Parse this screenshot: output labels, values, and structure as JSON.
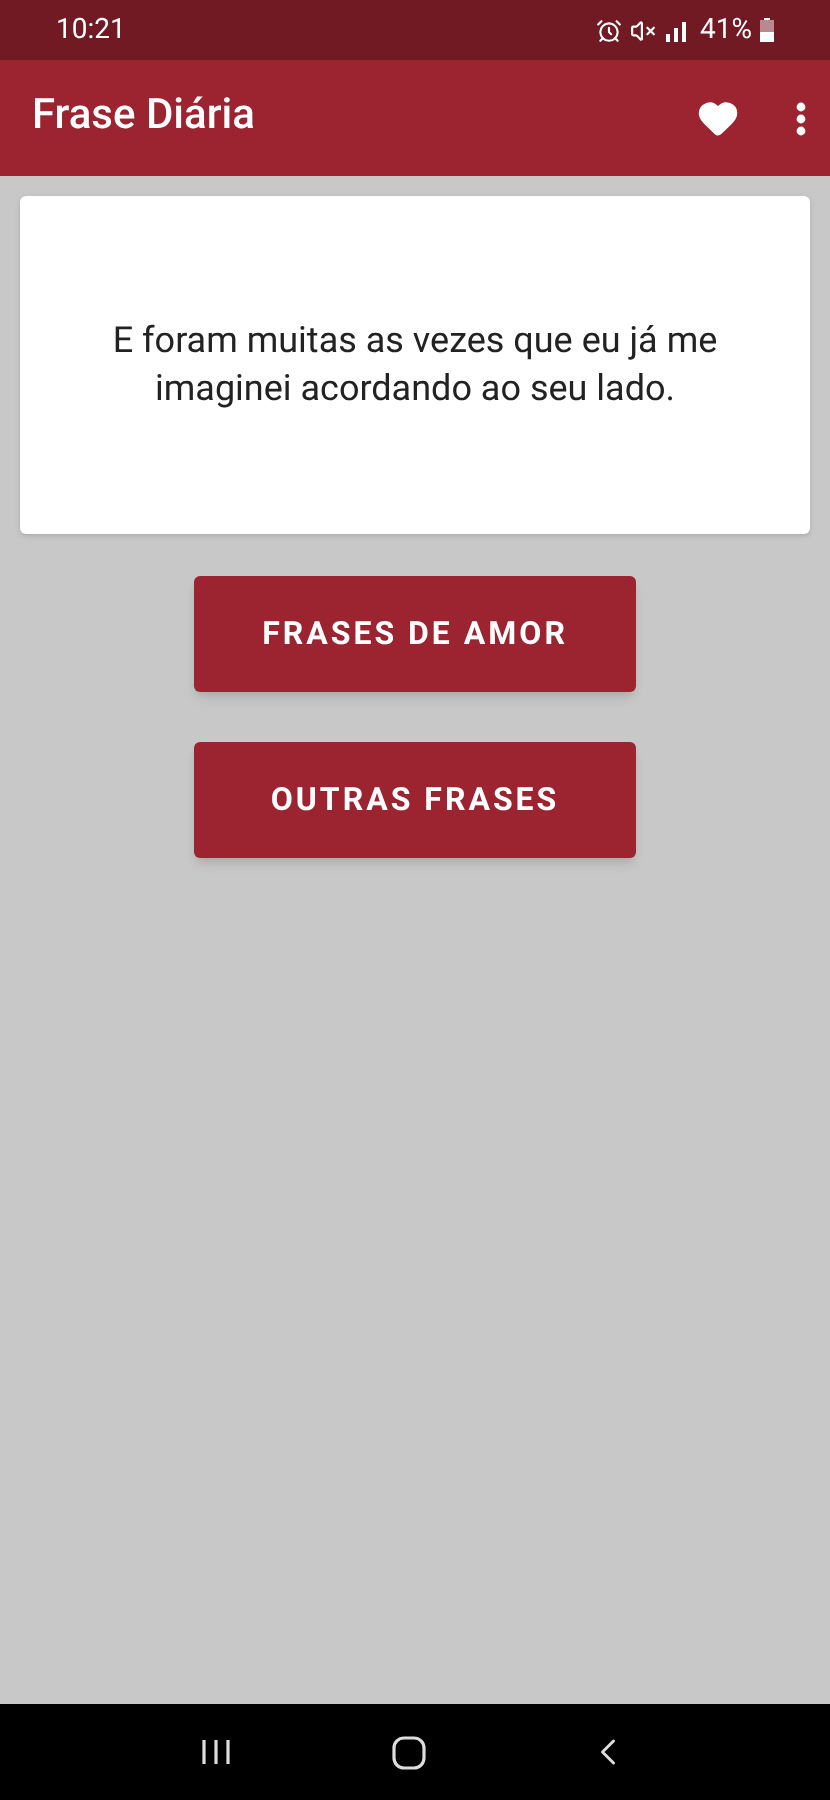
{
  "status_bar": {
    "time": "10:21",
    "battery": "41%"
  },
  "app_bar": {
    "title": "Frase Diária"
  },
  "quote": {
    "text": "E foram muitas as vezes que eu já me imaginei acordando ao seu lado."
  },
  "buttons": [
    "FRASES DE AMOR",
    "OUTRAS FRASES"
  ]
}
